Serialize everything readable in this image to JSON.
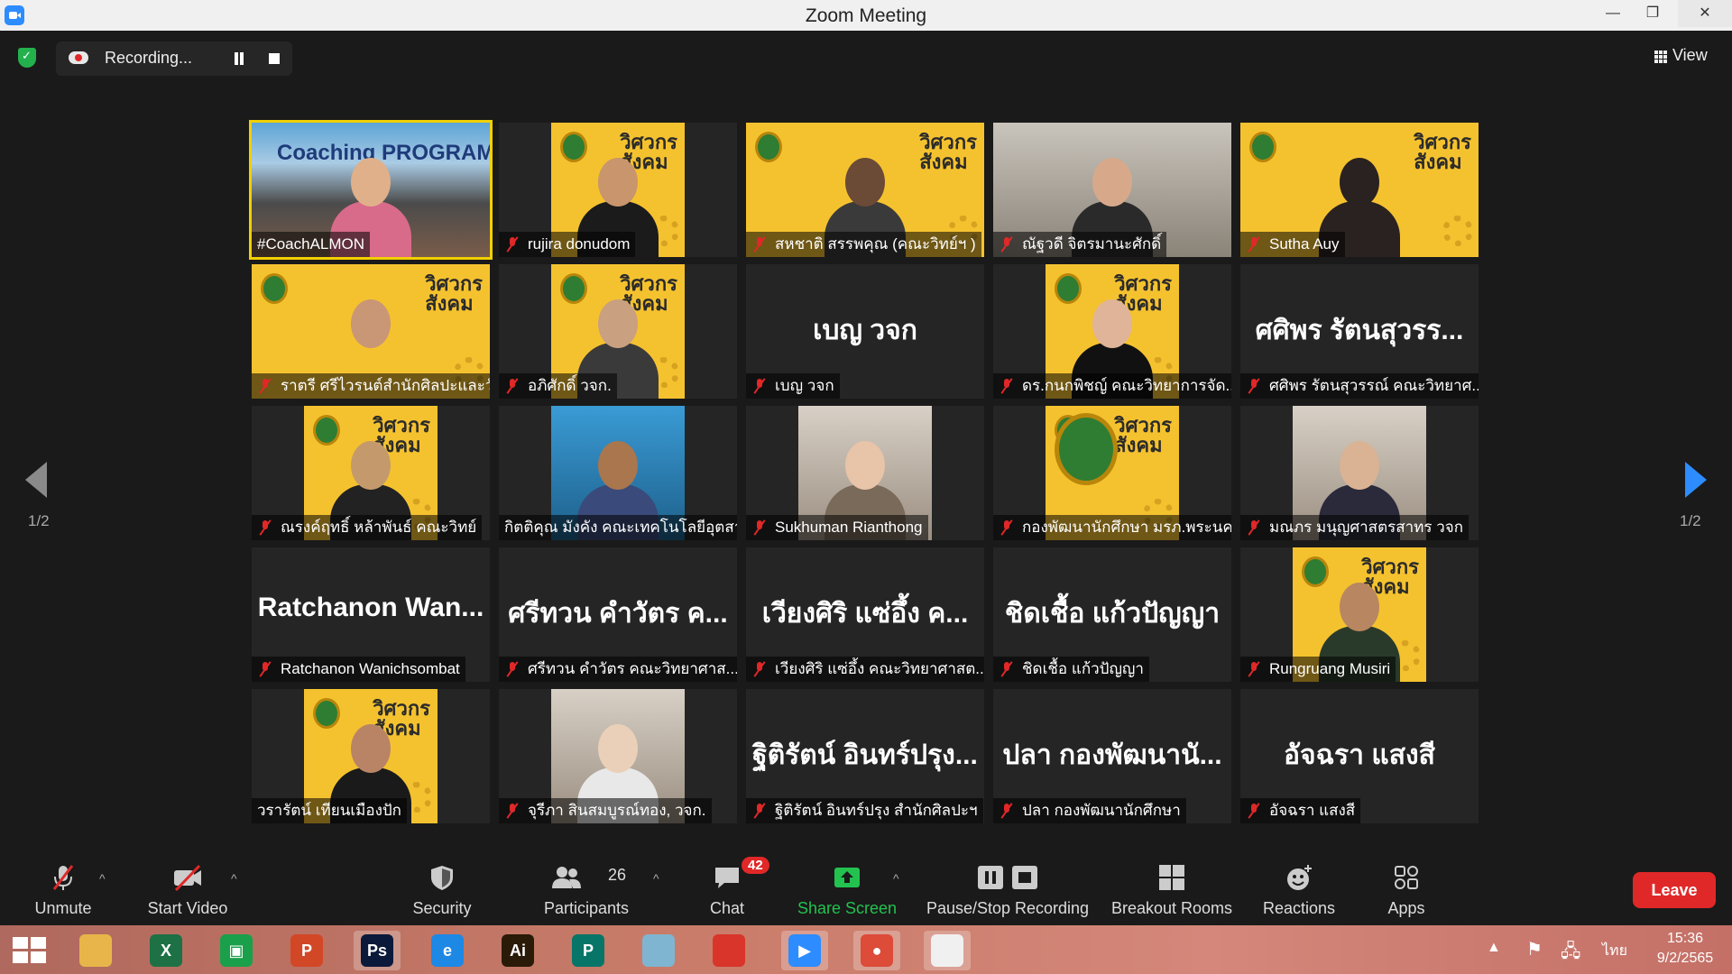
{
  "window": {
    "title": "Zoom Meeting",
    "minimize": "—",
    "restore": "❐",
    "close": "✕"
  },
  "recording": {
    "label": "Recording..."
  },
  "view": {
    "label": "View"
  },
  "pagination": {
    "left": "1/2",
    "right": "1/2"
  },
  "tiles": [
    {
      "name": "#CoachALMON",
      "type": "coach",
      "muted": false,
      "active": true,
      "poster_text": "Coaching PROGRAM for..."
    },
    {
      "name": "rujira donudom",
      "type": "poster",
      "muted": true,
      "skin": "#c8956c",
      "shirt": "#1b1b1b"
    },
    {
      "name": "สหชาติ สรรพคุณ (คณะวิทย์ฯ )",
      "type": "posterfull",
      "muted": true,
      "skin": "#6b4a36",
      "shirt": "#3a3a3a"
    },
    {
      "name": "ณัฐวดี จิตรมานะศักดิ์",
      "type": "office",
      "muted": true,
      "skin": "#d7a98a",
      "shirt": "#2a2a2a"
    },
    {
      "name": "Sutha Auy",
      "type": "posterfull",
      "muted": true,
      "skin": "#2a2220",
      "shirt": "#2a2220"
    },
    {
      "name": "ราตรี   ศรีไวรนต์สำนักศิลปะและวั...",
      "type": "posterfull",
      "muted": true,
      "skin": "#c99676",
      "shirt": "#f5c22f"
    },
    {
      "name": "อภิศักดิ์ วจก.",
      "type": "poster",
      "muted": true,
      "skin": "#c9a080",
      "shirt": "#3a3a3a"
    },
    {
      "name": "เบญ วจก",
      "type": "text",
      "muted": true,
      "big": "เบญ วจก"
    },
    {
      "name": "ดร.กนกพิชญ์ คณะวิทยาการจัด...",
      "type": "postersmall",
      "muted": true,
      "skin": "#e0b498",
      "shirt": "#111111"
    },
    {
      "name": "ศศิพร รัตนสุวรรณ์ คณะวิทยาศ...",
      "type": "text",
      "muted": true,
      "big": "ศศิพร รัตนสุวรร..."
    },
    {
      "name": "ณรงค์ฤทธิ์ หล้าพันธ์ คณะวิทย์",
      "type": "poster",
      "muted": true,
      "skin": "#c49a6c",
      "shirt": "#222222"
    },
    {
      "name": "กิตติคุณ มังคัง คณะเทคโนโลยีอุตสา...",
      "type": "cartoon",
      "muted": false,
      "skin": "#a9764e",
      "shirt": "#3a4a7a"
    },
    {
      "name": "Sukhuman Rianthong",
      "type": "photo",
      "muted": true,
      "skin": "#e8c4a8",
      "shirt": "#7a6a5a"
    },
    {
      "name": "กองพัฒนานักศึกษา มรภ.พระนคร",
      "type": "posterlogo",
      "muted": true
    },
    {
      "name": "มณภร มนุญศาสตรสาทร วจก",
      "type": "photo",
      "muted": true,
      "skin": "#d9b394",
      "shirt": "#2a2a3a"
    },
    {
      "name": "Ratchanon Wanichsombat",
      "type": "text",
      "muted": true,
      "big": "Ratchanon  Wan..."
    },
    {
      "name": "ศรีทวน  คำวัตร คณะวิทยาศาส...",
      "type": "text",
      "muted": true,
      "big": "ศรีทวน  คำวัตร ค..."
    },
    {
      "name": "เวียงศิริ  แซ่อึ้ง  คณะวิทยาศาสต...",
      "type": "text",
      "muted": true,
      "big": "เวียงศิริ  แซ่อึ้ง  ค..."
    },
    {
      "name": "ชิดเชื้อ แก้วปัญญา",
      "type": "text",
      "muted": true,
      "big": "ชิดเชื้อ แก้วปัญญา"
    },
    {
      "name": "Rungruang Musiri",
      "type": "poster",
      "muted": true,
      "skin": "#b88660",
      "shirt": "#2a3a2a"
    },
    {
      "name": "วรารัตน์ เทียนเมืองปัก",
      "type": "poster",
      "muted": false,
      "skin": "#b98466",
      "shirt": "#1a1a1a"
    },
    {
      "name": "จุรีภา สินสมบูรณ์ทอง, วจก.",
      "type": "photo",
      "muted": true,
      "skin": "#ead0b8",
      "shirt": "#e8e8e8"
    },
    {
      "name": "ฐิติรัตน์ อินทร์ปรุง สำนักศิลปะฯ",
      "type": "text",
      "muted": true,
      "big": "ฐิติรัตน์ อินทร์ปรุง..."
    },
    {
      "name": "ปลา กองพัฒนานักศึกษา",
      "type": "text",
      "muted": true,
      "big": "ปลา กองพัฒนานั..."
    },
    {
      "name": "อัจฉรา แสงสี",
      "type": "text",
      "muted": true,
      "big": "อัจฉรา แสงสี"
    }
  ],
  "poster": {
    "brand_line1": "วิศวกร",
    "brand_line2": "สังคม"
  },
  "toolbar": {
    "unmute": "Unmute",
    "start_video": "Start Video",
    "security": "Security",
    "participants": "Participants",
    "participants_count": "26",
    "chat": "Chat",
    "chat_badge": "42",
    "share_screen": "Share Screen",
    "pause_stop_recording": "Pause/Stop Recording",
    "breakout_rooms": "Breakout Rooms",
    "reactions": "Reactions",
    "apps": "Apps",
    "leave": "Leave",
    "caret": "^"
  },
  "taskbar": {
    "apps": [
      {
        "name": "file-explorer",
        "glyph": "",
        "color": "#e8b54a"
      },
      {
        "name": "excel",
        "glyph": "X",
        "color": "#1e7145"
      },
      {
        "name": "store",
        "glyph": "▣",
        "color": "#1aa04a"
      },
      {
        "name": "powerpoint",
        "glyph": "P",
        "color": "#d24726"
      },
      {
        "name": "photoshop",
        "glyph": "Ps",
        "color": "#0b1a3a"
      },
      {
        "name": "internet-explorer",
        "glyph": "e",
        "color": "#1e88e5"
      },
      {
        "name": "illustrator",
        "glyph": "Ai",
        "color": "#2a1a08"
      },
      {
        "name": "publisher",
        "glyph": "P",
        "color": "#077568"
      },
      {
        "name": "notes",
        "glyph": "",
        "color": "#7fb5d0"
      },
      {
        "name": "photoscape",
        "glyph": "",
        "color": "#d9352a"
      },
      {
        "name": "zoom",
        "glyph": "▶",
        "color": "#2d8cff"
      },
      {
        "name": "chrome",
        "glyph": "●",
        "color": "#dd4b39"
      },
      {
        "name": "snip",
        "glyph": "",
        "color": "#f0f0f0"
      }
    ],
    "lang": "ไทย",
    "time": "15:36",
    "date": "9/2/2565"
  }
}
